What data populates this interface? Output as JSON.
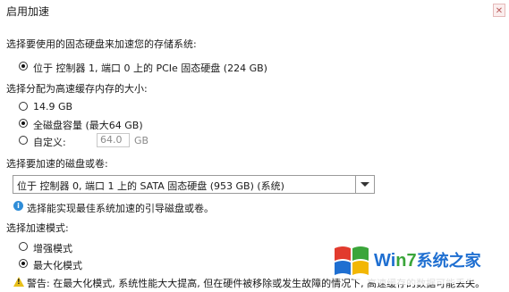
{
  "window": {
    "title": "启用加速",
    "close_symbol": "✕"
  },
  "ssd_section": {
    "label": "选择要使用的固态硬盘来加速您的存储系统:",
    "option": "位于 控制器 1, 端口 0 上的 PCIe 固态硬盘 (224 GB)"
  },
  "cache_section": {
    "label": "选择分配为高速缓存内存的大小:",
    "options": [
      "14.9 GB",
      "全磁盘容量 (最大64 GB)",
      "自定义:"
    ],
    "custom_value": "64.0",
    "custom_unit": "GB"
  },
  "disk_section": {
    "label": "选择要加速的磁盘或卷:",
    "selected": "位于 控制器 0, 端口 1 上的 SATA 固态硬盘 (953 GB) (系统)",
    "hint": "选择能实现最佳系统加速的引导磁盘或卷。",
    "hint_icon": "i"
  },
  "mode_section": {
    "label": "选择加速模式:",
    "options": [
      "增强模式",
      "最大化模式"
    ],
    "warning": "警告: 在最大化模式, 系统性能大大提高, 但在硬件被移除或发生故障的情况下, 高速缓存的数据可能丢失。",
    "warning_icon": "!"
  },
  "watermark": {
    "text_a": "Wi",
    "text_b": "n7",
    "text_c": "系统之家",
    "colors": {
      "red": "#e23b2e",
      "green": "#3aa53a",
      "blue": "#1f6fd1",
      "yellow": "#f2b705"
    }
  }
}
